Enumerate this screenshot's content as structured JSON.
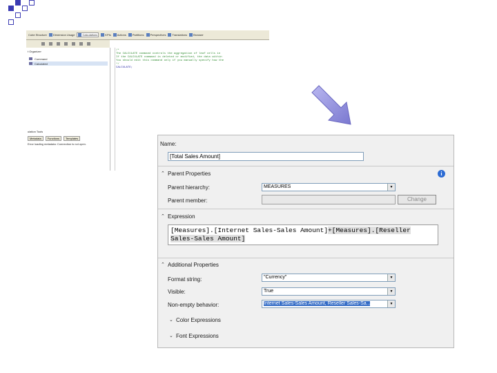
{
  "colors": {
    "bullet": "#3b3bb3",
    "accent": "#316ac5",
    "arrow": "#8d8bd9"
  },
  "bullets": [
    "square-bullet",
    "square-bullet",
    "square-bullet",
    "square-bullet"
  ],
  "top_shot": {
    "tabs": [
      {
        "label": "Cube Structure",
        "active": false
      },
      {
        "label": "Dimension Usage",
        "active": false
      },
      {
        "label": "Calculations",
        "active": true
      },
      {
        "label": "KPIs",
        "active": false
      },
      {
        "label": "Actions",
        "active": false
      },
      {
        "label": "Partitions",
        "active": false
      },
      {
        "label": "Perspectives",
        "active": false
      },
      {
        "label": "Translations",
        "active": false
      },
      {
        "label": "Browser",
        "active": false
      }
    ],
    "script_organizer_title": "t Organizer",
    "organizer_items": [
      {
        "label": "Command",
        "selected": false
      },
      {
        "label": "Calculated",
        "selected": true
      }
    ],
    "calc_tools_title": "ulation Tools",
    "calc_tools_tabs": [
      "Metadata",
      "Functions",
      "Templates"
    ],
    "calc_tools_message": "Error loading metadata: Connection is not open.",
    "code_lines": [
      "/*",
      "The CALCULATE command controls the aggregation of leaf cells in",
      "If the CALCULATE command is deleted or modified, the data within",
      "You should edit this command only if you manually specify how the",
      "*/",
      "CALCULATE;"
    ]
  },
  "dialog": {
    "name_label": "Name:",
    "name_value": "[Total Sales Amount]",
    "parent_properties_label": "Parent Properties",
    "parent_hierarchy_label": "Parent hierarchy:",
    "parent_hierarchy_value": "MEASURES",
    "parent_member_label": "Parent member:",
    "change_button": "Change",
    "expression_label": "Expression",
    "expression_line1_a": "[Measures].[Internet Sales-Sales Amount]",
    "expression_line1_b": "+[Measures].[Reseller",
    "expression_line2": "Sales-Sales Amount]",
    "additional_properties_label": "Additional Properties",
    "format_string_label": "Format string:",
    "format_string_value": "\"Currency\"",
    "visible_label": "Visible:",
    "visible_value": "True",
    "non_empty_label": "Non-empty behavior:",
    "non_empty_value": "Internet Sales-Sales Amount, Reseller Sales-Sa...",
    "color_expressions_label": "Color Expressions",
    "font_expressions_label": "Font Expressions"
  }
}
